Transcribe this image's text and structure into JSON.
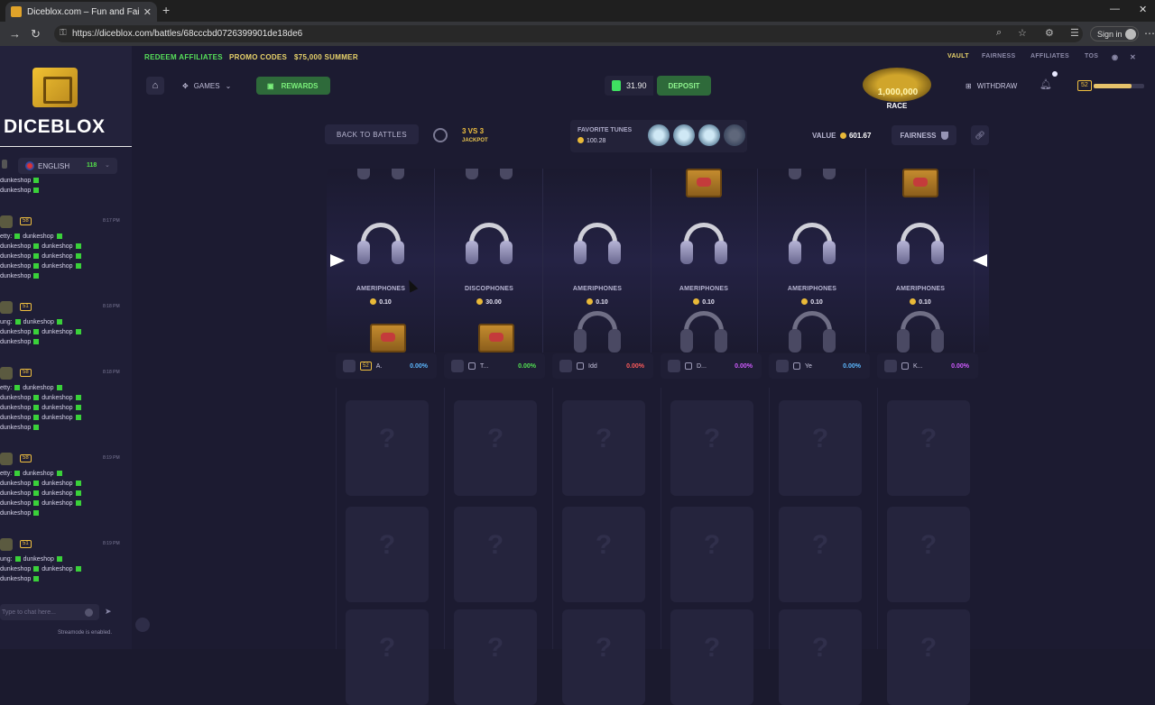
{
  "browser": {
    "tab_title": "Diceblox.com – Fun and Fair Gam",
    "url": "https://diceblox.com/battles/68cccbd0726399901de18de6",
    "signin": "Sign in"
  },
  "nav": {
    "promos": [
      "REDEEM AFFILIATES",
      "PROMO CODES",
      "$75,000 SUMMER"
    ],
    "right_links": [
      "VAULT",
      "FAIRNESS",
      "AFFILIATES",
      "TOS"
    ],
    "games": "GAMES",
    "rewards": "REWARDS",
    "balance": "31.90",
    "deposit": "DEPOSIT",
    "race_amount": "1,000,000",
    "race_label": "RACE",
    "withdraw": "WITHDRAW",
    "level": "52",
    "xp_progress": 0.75
  },
  "sidebar": {
    "logo": "DICEBLOX",
    "language": "ENGLISH",
    "online": "118",
    "chat_placeholder": "Type to chat here...",
    "streamer_note": "Streamode is enabled.",
    "messages": [
      {
        "badge": "",
        "time": "",
        "lines": [
          "dunkeshop",
          "dunkeshop"
        ]
      },
      {
        "badge": "58",
        "time": "8:17 PM",
        "lines": [
          "etty:  dunkeshop",
          "dunkeshop  dunkeshop",
          "dunkeshop  dunkeshop",
          "dunkeshop  dunkeshop",
          "dunkeshop"
        ]
      },
      {
        "badge": "51",
        "time": "8:18 PM",
        "lines": [
          "ung:  dunkeshop",
          "dunkeshop  dunkeshop",
          "dunkeshop"
        ]
      },
      {
        "badge": "58",
        "time": "8:18 PM",
        "lines": [
          "etty:  dunkeshop",
          "dunkeshop  dunkeshop",
          "dunkeshop  dunkeshop",
          "dunkeshop  dunkeshop",
          "dunkeshop"
        ]
      },
      {
        "badge": "58",
        "time": "8:19 PM",
        "lines": [
          "etty:  dunkeshop",
          "dunkeshop  dunkeshop",
          "dunkeshop  dunkeshop",
          "dunkeshop  dunkeshop",
          "dunkeshop"
        ]
      },
      {
        "badge": "51",
        "time": "8:19 PM",
        "lines": [
          "ung:  dunkeshop",
          "dunkeshop  dunkeshop",
          "dunkeshop"
        ]
      }
    ]
  },
  "battle": {
    "back": "BACK TO BATTLES",
    "mode": "3 VS 3",
    "mode_sub": "JACKPOT",
    "fav_title": "FAVORITE TUNES",
    "fav_value": "100.28",
    "value_label": "VALUE",
    "value": "601.67",
    "fairness": "FAIRNESS"
  },
  "reels": [
    {
      "name": "AMERIPHONES",
      "price": "0.10",
      "top": "headphone",
      "bottom": "crate"
    },
    {
      "name": "DISCOPHONES",
      "price": "30.00",
      "top": "headphone",
      "bottom": "crate"
    },
    {
      "name": "AMERIPHONES",
      "price": "0.10",
      "top": "none",
      "bottom": "headphone"
    },
    {
      "name": "AMERIPHONES",
      "price": "0.10",
      "top": "crate",
      "bottom": "headphone"
    },
    {
      "name": "AMERIPHONES",
      "price": "0.10",
      "top": "headphone",
      "bottom": "headphone"
    },
    {
      "name": "AMERIPHONES",
      "price": "0.10",
      "top": "crate",
      "bottom": "headphone"
    }
  ],
  "players": [
    {
      "name": "A.",
      "level": "52",
      "pct": "0.00%",
      "pct_color": "#5cb8ff"
    },
    {
      "name": "T...",
      "level": "",
      "pct": "0.00%",
      "pct_color": "#52e052"
    },
    {
      "name": "Idd",
      "level": "",
      "pct": "0.00%",
      "pct_color": "#ff5b5b"
    },
    {
      "name": "D...",
      "level": "",
      "pct": "0.00%",
      "pct_color": "#d05bff"
    },
    {
      "name": "Ye",
      "level": "",
      "pct": "0.00%",
      "pct_color": "#5cb8ff"
    },
    {
      "name": "K...",
      "level": "",
      "pct": "0.00%",
      "pct_color": "#d05bff"
    }
  ],
  "slot_mark": "?"
}
